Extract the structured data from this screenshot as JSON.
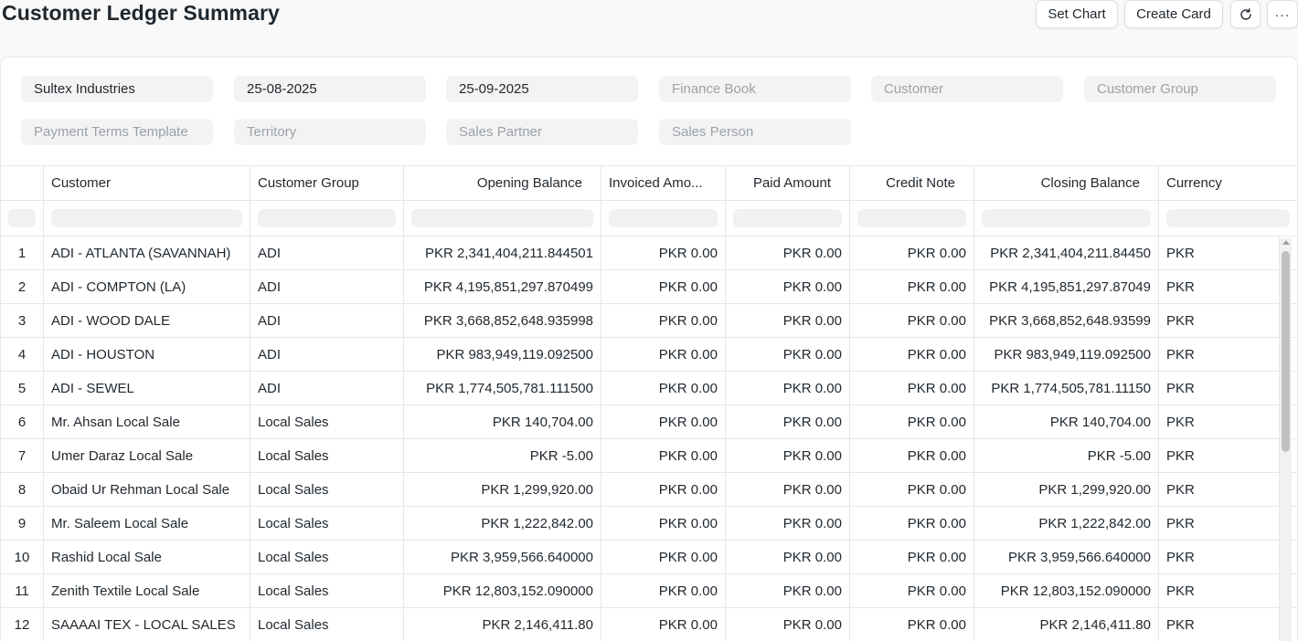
{
  "page": {
    "title": "Customer Ledger Summary"
  },
  "toolbar": {
    "set_chart": "Set Chart",
    "create_card": "Create Card",
    "more": "···"
  },
  "filters": [
    {
      "value": "Sultex Industries",
      "placeholder": ""
    },
    {
      "value": "25-08-2025",
      "placeholder": ""
    },
    {
      "value": "25-09-2025",
      "placeholder": ""
    },
    {
      "value": "",
      "placeholder": "Finance Book"
    },
    {
      "value": "",
      "placeholder": "Customer"
    },
    {
      "value": "",
      "placeholder": "Customer Group"
    },
    {
      "value": "",
      "placeholder": "Payment Terms Template"
    },
    {
      "value": "",
      "placeholder": "Territory"
    },
    {
      "value": "",
      "placeholder": "Sales Partner"
    },
    {
      "value": "",
      "placeholder": "Sales Person"
    }
  ],
  "table": {
    "columns": [
      "Customer",
      "Customer Group",
      "Opening Balance",
      "Invoiced Amo...",
      "Paid Amount",
      "Credit Note",
      "Closing Balance",
      "Currency"
    ],
    "rows": [
      {
        "num": "1",
        "customer": "ADI - ATLANTA (SAVANNAH)",
        "group": "ADI",
        "opening": "PKR 2,341,404,211.844501",
        "invoiced": "PKR 0.00",
        "paid": "PKR 0.00",
        "credit": "PKR 0.00",
        "closing": "PKR 2,341,404,211.84450",
        "currency": "PKR"
      },
      {
        "num": "2",
        "customer": "ADI - COMPTON (LA)",
        "group": "ADI",
        "opening": "PKR 4,195,851,297.870499",
        "invoiced": "PKR 0.00",
        "paid": "PKR 0.00",
        "credit": "PKR 0.00",
        "closing": "PKR 4,195,851,297.87049",
        "currency": "PKR"
      },
      {
        "num": "3",
        "customer": "ADI - WOOD DALE",
        "group": "ADI",
        "opening": "PKR 3,668,852,648.935998",
        "invoiced": "PKR 0.00",
        "paid": "PKR 0.00",
        "credit": "PKR 0.00",
        "closing": "PKR 3,668,852,648.93599",
        "currency": "PKR"
      },
      {
        "num": "4",
        "customer": "ADI - HOUSTON",
        "group": "ADI",
        "opening": "PKR 983,949,119.092500",
        "invoiced": "PKR 0.00",
        "paid": "PKR 0.00",
        "credit": "PKR 0.00",
        "closing": "PKR 983,949,119.092500",
        "currency": "PKR"
      },
      {
        "num": "5",
        "customer": "ADI - SEWEL",
        "group": "ADI",
        "opening": "PKR 1,774,505,781.111500",
        "invoiced": "PKR 0.00",
        "paid": "PKR 0.00",
        "credit": "PKR 0.00",
        "closing": "PKR 1,774,505,781.11150",
        "currency": "PKR"
      },
      {
        "num": "6",
        "customer": "Mr. Ahsan Local Sale",
        "group": "Local Sales",
        "opening": "PKR 140,704.00",
        "invoiced": "PKR 0.00",
        "paid": "PKR 0.00",
        "credit": "PKR 0.00",
        "closing": "PKR 140,704.00",
        "currency": "PKR"
      },
      {
        "num": "7",
        "customer": "Umer Daraz Local Sale",
        "group": "Local Sales",
        "opening": "PKR -5.00",
        "invoiced": "PKR 0.00",
        "paid": "PKR 0.00",
        "credit": "PKR 0.00",
        "closing": "PKR -5.00",
        "currency": "PKR"
      },
      {
        "num": "8",
        "customer": "Obaid Ur Rehman Local Sale",
        "group": "Local Sales",
        "opening": "PKR 1,299,920.00",
        "invoiced": "PKR 0.00",
        "paid": "PKR 0.00",
        "credit": "PKR 0.00",
        "closing": "PKR 1,299,920.00",
        "currency": "PKR"
      },
      {
        "num": "9",
        "customer": "Mr. Saleem Local Sale",
        "group": "Local Sales",
        "opening": "PKR 1,222,842.00",
        "invoiced": "PKR 0.00",
        "paid": "PKR 0.00",
        "credit": "PKR 0.00",
        "closing": "PKR 1,222,842.00",
        "currency": "PKR"
      },
      {
        "num": "10",
        "customer": "Rashid Local Sale",
        "group": "Local Sales",
        "opening": "PKR 3,959,566.640000",
        "invoiced": "PKR 0.00",
        "paid": "PKR 0.00",
        "credit": "PKR 0.00",
        "closing": "PKR 3,959,566.640000",
        "currency": "PKR"
      },
      {
        "num": "11",
        "customer": "Zenith Textile Local Sale",
        "group": "Local Sales",
        "opening": "PKR 12,803,152.090000",
        "invoiced": "PKR 0.00",
        "paid": "PKR 0.00",
        "credit": "PKR 0.00",
        "closing": "PKR 12,803,152.090000",
        "currency": "PKR"
      },
      {
        "num": "12",
        "customer": "SAAAAI TEX - LOCAL SALES",
        "group": "Local Sales",
        "opening": "PKR 2,146,411.80",
        "invoiced": "PKR 0.00",
        "paid": "PKR 0.00",
        "credit": "PKR 0.00",
        "closing": "PKR 2,146,411.80",
        "currency": "PKR"
      }
    ]
  }
}
